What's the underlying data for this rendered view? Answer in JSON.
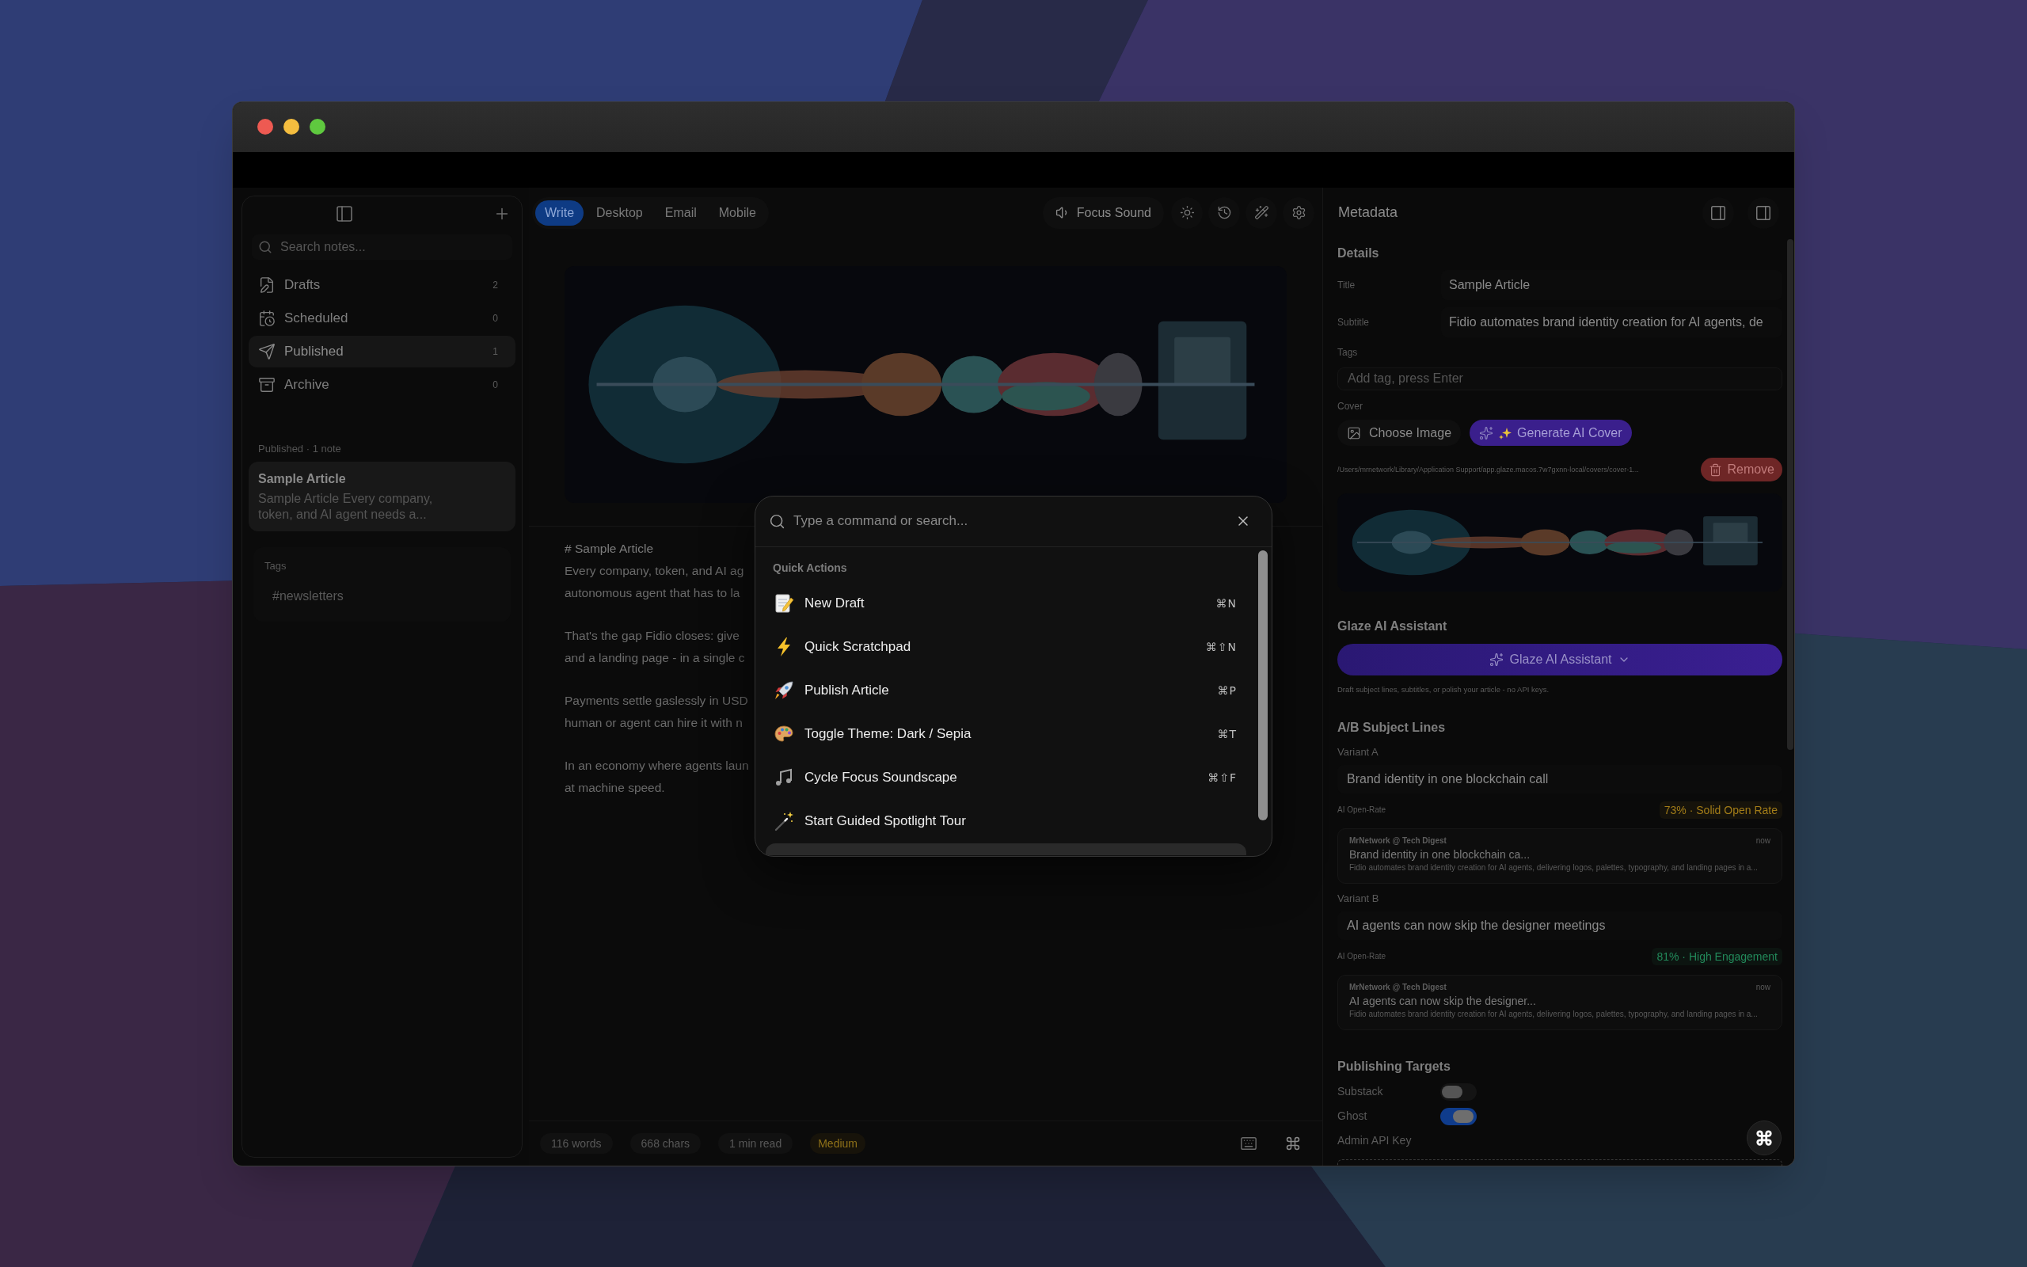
{
  "sidebar": {
    "search": {
      "placeholder": "Search notes..."
    },
    "items": [
      {
        "label": "Drafts",
        "count": "2",
        "selected": false
      },
      {
        "label": "Scheduled",
        "count": "0",
        "selected": false
      },
      {
        "label": "Published",
        "count": "1",
        "selected": true
      },
      {
        "label": "Archive",
        "count": "0",
        "selected": false
      }
    ],
    "list_heading": "Published · 1 note",
    "notes": [
      {
        "title": "Sample Article",
        "preview": "Sample Article Every company, token, and AI agent needs a...",
        "selected": true
      }
    ],
    "tags": {
      "heading": "Tags",
      "items": [
        "#newsletters"
      ]
    }
  },
  "editor": {
    "tabs": [
      {
        "label": "Write",
        "selected": true
      },
      {
        "label": "Desktop",
        "selected": false
      },
      {
        "label": "Email",
        "selected": false
      },
      {
        "label": "Mobile",
        "selected": false
      }
    ],
    "focus_sound": "Focus Sound",
    "paragraphs": [
      [
        "# Sample Article",
        "Every company, token, and AI ag",
        "autonomous agent that has to la"
      ],
      [
        "That's the gap Fidio closes: give",
        "and a landing page - in a single c"
      ],
      [
        "Payments settle gaslessly in USD",
        "human or agent can hire it with n"
      ],
      [
        "In an economy where agents laun",
        "at machine speed."
      ]
    ],
    "status": [
      {
        "text": "116 words",
        "kind": "stat"
      },
      {
        "text": "668 chars",
        "kind": "stat"
      },
      {
        "text": "1 min read",
        "kind": "stat"
      },
      {
        "text": "Medium",
        "kind": "grade"
      }
    ]
  },
  "metadata": {
    "title": "Metadata",
    "details": {
      "heading": "Details",
      "fields": [
        {
          "label": "Title",
          "value": "Sample Article"
        },
        {
          "label": "Subtitle",
          "value": "Fidio automates brand identity creation for AI agents, de"
        }
      ],
      "tags": {
        "label": "Tags",
        "placeholder": "Add tag, press Enter"
      },
      "cover": {
        "label": "Cover",
        "buttons": [
          {
            "label": "Choose Image",
            "kind": "secondary"
          },
          {
            "label": "Generate AI Cover",
            "kind": "ai"
          }
        ],
        "path": "/Users/mrnetwork/Library/Application Support/app.glaze.macos.7w7gxnn-local/covers/cover-1...",
        "remove": "Remove"
      }
    },
    "assistant": {
      "heading": "Glaze AI Assistant",
      "button": "Glaze AI Assistant",
      "hint": "Draft subject lines, subtitles, or polish your article - no API keys."
    },
    "ab_test": {
      "heading": "A/B Subject Lines",
      "variants": [
        {
          "label": "Variant A",
          "subject": "Brand identity in one blockchain call",
          "score_label": "AI Open-Rate",
          "score": "73% · Solid Open Rate",
          "color": "#a27c18",
          "preview": {
            "sender": "MrNetwork @ Tech Digest",
            "time": "now",
            "subject": "Brand identity in one blockchain ca...",
            "snippet": "Fidio automates brand identity creation for AI agents, delivering logos, palettes, typography, and landing pages in a..."
          }
        },
        {
          "label": "Variant B",
          "subject": "AI agents can now skip the designer meetings",
          "score_label": "AI Open-Rate",
          "score": "81% · High Engagement",
          "color": "#22895a",
          "preview": {
            "sender": "MrNetwork @ Tech Digest",
            "time": "now",
            "subject": "AI agents can now skip the designer...",
            "snippet": "Fidio automates brand identity creation for AI agents, delivering logos, palettes, typography, and landing pages in a..."
          }
        }
      ]
    },
    "publishing": {
      "heading": "Publishing Targets",
      "targets": [
        {
          "label": "Substack",
          "on": false
        },
        {
          "label": "Ghost",
          "on": true
        }
      ],
      "api_key": {
        "label": "Admin API Key"
      }
    }
  },
  "command_palette": {
    "placeholder": "Type a command or search...",
    "section": "Quick Actions",
    "items": [
      {
        "label": "New Draft",
        "shortcut": "⌘N",
        "selected": false
      },
      {
        "label": "Quick Scratchpad",
        "shortcut": "⌘⇧N",
        "selected": false
      },
      {
        "label": "Publish Article",
        "shortcut": "⌘P",
        "selected": false
      },
      {
        "label": "Toggle Theme: Dark / Sepia",
        "shortcut": "⌘T",
        "selected": false
      },
      {
        "label": "Cycle Focus Soundscape",
        "shortcut": "⌘⇧F",
        "selected": false
      },
      {
        "label": "Start Guided Spotlight Tour",
        "selected": false
      },
      {
        "selected": true
      }
    ]
  }
}
